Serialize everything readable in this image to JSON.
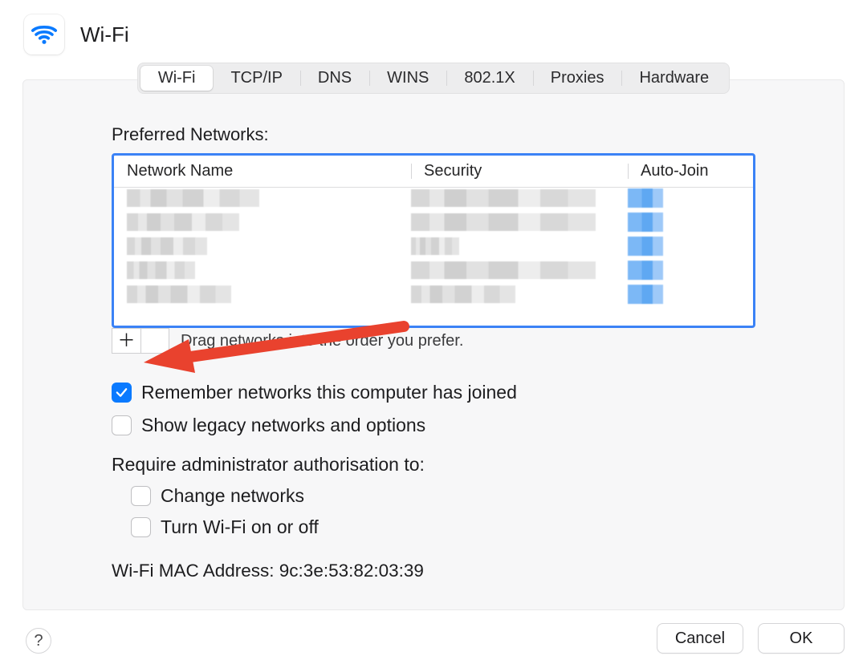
{
  "header": {
    "title": "Wi-Fi"
  },
  "tabs": {
    "items": [
      {
        "label": "Wi-Fi",
        "active": true
      },
      {
        "label": "TCP/IP",
        "active": false
      },
      {
        "label": "DNS",
        "active": false
      },
      {
        "label": "WINS",
        "active": false
      },
      {
        "label": "802.1X",
        "active": false
      },
      {
        "label": "Proxies",
        "active": false
      },
      {
        "label": "Hardware",
        "active": false
      }
    ]
  },
  "preferred": {
    "section_label": "Preferred Networks:",
    "columns": {
      "name": "Network Name",
      "security": "Security",
      "autojoin": "Auto-Join"
    },
    "rows": [
      {
        "name_redacted": true,
        "security_redacted": true,
        "autojoin_redacted": true
      },
      {
        "name_redacted": true,
        "security_redacted": true,
        "autojoin_redacted": true
      },
      {
        "name_redacted": true,
        "security_redacted": true,
        "autojoin_redacted": true
      },
      {
        "name_redacted": true,
        "security_redacted": true,
        "autojoin_redacted": true
      },
      {
        "name_redacted": true,
        "security_redacted": true,
        "autojoin_redacted": true
      }
    ],
    "add_glyph": "＋",
    "remove_glyph": "－",
    "drag_hint": "Drag networks into the order you prefer."
  },
  "options": {
    "remember_label": "Remember networks this computer has joined",
    "remember_checked": true,
    "legacy_label": "Show legacy networks and options",
    "legacy_checked": false,
    "require_label": "Require administrator authorisation to:",
    "change_networks_label": "Change networks",
    "change_networks_checked": false,
    "toggle_wifi_label": "Turn Wi-Fi on or off",
    "toggle_wifi_checked": false
  },
  "mac": {
    "label": "Wi-Fi MAC Address:",
    "value": "9c:3e:53:82:03:39"
  },
  "footer": {
    "help_glyph": "?",
    "cancel": "Cancel",
    "ok": "OK"
  },
  "colors": {
    "accent": "#0a7aff",
    "table_focus": "#3b82f6",
    "annotation_arrow": "#e9422e"
  }
}
